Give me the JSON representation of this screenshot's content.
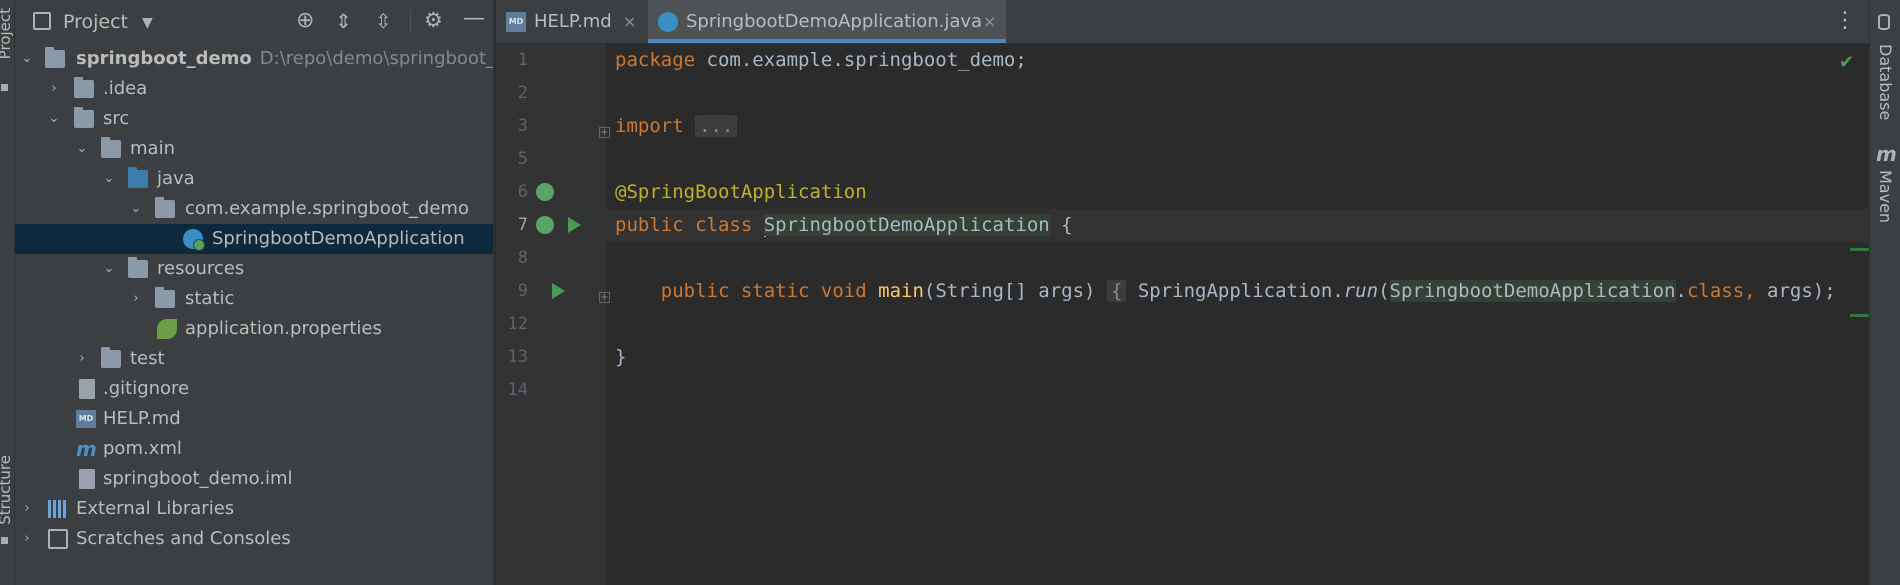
{
  "left_strip": {
    "project_label": "Project",
    "structure_label": "Structure"
  },
  "project_panel": {
    "title": "Project",
    "tree": [
      {
        "label": "springboot_demo",
        "path": "D:\\repo\\demo\\springboot_d"
      },
      {
        "label": ".idea"
      },
      {
        "label": "src"
      },
      {
        "label": "main"
      },
      {
        "label": "java"
      },
      {
        "label": "com.example.springboot_demo"
      },
      {
        "label": "SpringbootDemoApplication"
      },
      {
        "label": "resources"
      },
      {
        "label": "static"
      },
      {
        "label": "application.properties"
      },
      {
        "label": "test"
      },
      {
        "label": ".gitignore"
      },
      {
        "label": "HELP.md"
      },
      {
        "label": "pom.xml"
      },
      {
        "label": "springboot_demo.iml"
      },
      {
        "label": "External Libraries"
      },
      {
        "label": "Scratches and Consoles"
      }
    ]
  },
  "tabs": [
    {
      "label": "HELP.md",
      "icon_text": "MD",
      "close": "×"
    },
    {
      "label": "SpringbootDemoApplication.java",
      "close": "×",
      "active": true
    }
  ],
  "editor": {
    "line_numbers": [
      "1",
      "2",
      "3",
      "5",
      "6",
      "7",
      "8",
      "9",
      "12",
      "13",
      "14"
    ],
    "current_line": "7",
    "code": {
      "l1": {
        "kw": "package",
        "rest": " com.example.springboot_demo;"
      },
      "l3": {
        "kw": "import",
        "fold": "..."
      },
      "l6": {
        "ann": "@SpringBootApplication"
      },
      "l7": {
        "kw": "public class",
        "cls": "SpringbootDemoApplication",
        "rest": " {"
      },
      "l9": {
        "kw": "public static void",
        "fn": "main",
        "sig": "(String[] args)",
        "fold": "{",
        "call_obj": " SpringApplication.",
        "call": "run",
        "paren": "(",
        "cls": "SpringbootDemoApplication",
        "dot": ".",
        "kw2": "class,",
        "args": " args);"
      },
      "l13": {
        "text": "}"
      }
    },
    "status": "check"
  },
  "right_strip": {
    "database_label": "Database",
    "maven_label": "Maven"
  },
  "colors": {
    "accent": "#4a88c7",
    "selection": "#0d293e",
    "keyword": "#cc7832",
    "annotation": "#bbb529",
    "function": "#ffc66d"
  }
}
